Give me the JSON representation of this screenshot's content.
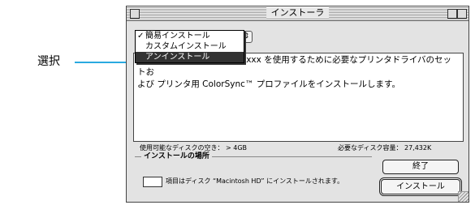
{
  "annotation": {
    "label": "選択",
    "color": "#2aa9e0"
  },
  "window": {
    "title": "インストーラ",
    "popup": {
      "items": [
        {
          "label": "簡易インストール",
          "checked": true,
          "selected": false
        },
        {
          "label": "カスタムインストール",
          "checked": false,
          "selected": false
        },
        {
          "label": "アンインストール",
          "checked": false,
          "selected": true
        }
      ]
    },
    "description": {
      "line1": "xxxx を使用するために必要なプリンタドライバのセットお",
      "line2": "よび プリンタ用 ColorSync™ プロファイルをインストールします。"
    },
    "disk_available": "使用可能なディスクの空き： > 4GB",
    "disk_required": "必要なディスク容量： 27,432K",
    "location": {
      "group_title": "インストールの場所",
      "text": "項目はディスク “Macintosh HD” にインストールされます。"
    },
    "buttons": {
      "quit": "終了",
      "install": "インストール"
    }
  }
}
